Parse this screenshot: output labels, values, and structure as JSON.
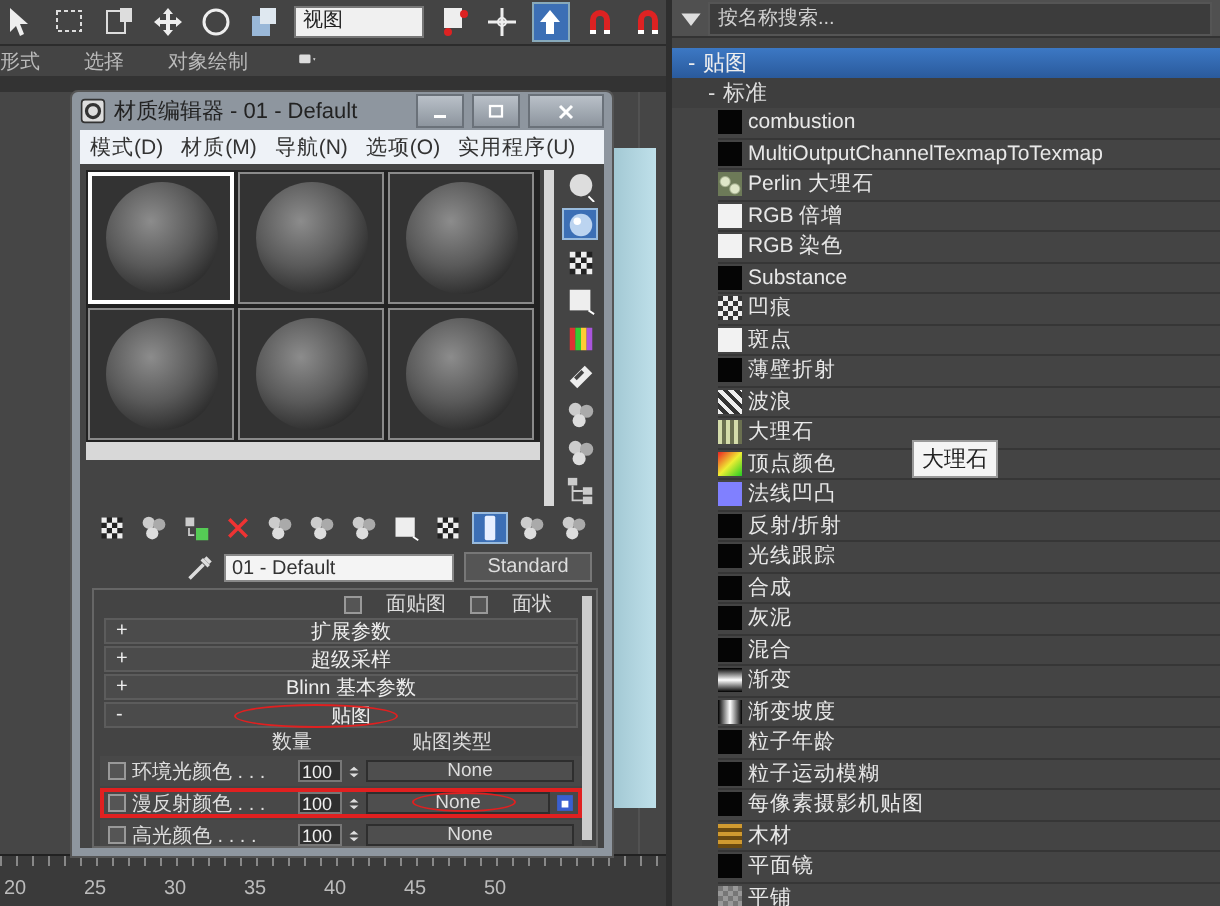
{
  "top_toolbar": {
    "tools": [
      {
        "kind": "cursor",
        "selected": false
      },
      {
        "kind": "rect-select",
        "selected": false
      },
      {
        "kind": "window-select",
        "selected": false
      },
      {
        "kind": "move",
        "selected": false
      },
      {
        "kind": "rotate",
        "selected": false
      },
      {
        "kind": "scale",
        "selected": false
      },
      {
        "kind": "field",
        "value": "视图"
      },
      {
        "kind": "pivot",
        "selected": false
      },
      {
        "kind": "snap",
        "selected": false
      },
      {
        "kind": "up-arrow",
        "selected": true
      },
      {
        "kind": "magnet",
        "selected": false
      },
      {
        "kind": "magnet",
        "selected": false
      }
    ]
  },
  "ribbon_labels": [
    "形式",
    "选择",
    "对象绘制"
  ],
  "material_editor": {
    "title": "材质编辑器 - 01 - Default",
    "menu": [
      "模式(D)",
      "材质(M)",
      "导航(N)",
      "选项(O)",
      "实用程序(U)"
    ],
    "spheres": [
      {
        "selected": true
      },
      {
        "selected": false
      },
      {
        "selected": false
      },
      {
        "selected": false
      },
      {
        "selected": false
      },
      {
        "selected": false
      }
    ],
    "side_tools": [
      {
        "kind": "sphere",
        "selected": false
      },
      {
        "kind": "light",
        "selected": true
      },
      {
        "kind": "checker",
        "selected": false
      },
      {
        "kind": "square",
        "selected": false
      },
      {
        "kind": "bars",
        "selected": false
      },
      {
        "kind": "tape",
        "selected": false
      },
      {
        "kind": "spheres",
        "selected": false
      },
      {
        "kind": "spheres",
        "selected": false
      },
      {
        "kind": "tree",
        "selected": false
      }
    ],
    "bottom_tools": [
      {
        "kind": "checker",
        "selected": false
      },
      {
        "kind": "spheres",
        "selected": false
      },
      {
        "kind": "assign",
        "selected": false
      },
      {
        "kind": "delete",
        "selected": false
      },
      {
        "kind": "spheres",
        "selected": false
      },
      {
        "kind": "spheres",
        "selected": false
      },
      {
        "kind": "spheres",
        "selected": false
      },
      {
        "kind": "square",
        "selected": false
      },
      {
        "kind": "checker",
        "selected": false
      },
      {
        "kind": "bar",
        "selected": true
      },
      {
        "kind": "spheres",
        "selected": false
      },
      {
        "kind": "spheres",
        "selected": false
      }
    ],
    "material_name": "01 - Default",
    "material_type": "Standard",
    "checkboxes": [
      {
        "label": "面贴图",
        "checked": false
      },
      {
        "label": "面状",
        "checked": false
      }
    ],
    "rollouts": [
      {
        "toggle": "+",
        "label": "扩展参数",
        "circled": false
      },
      {
        "toggle": "+",
        "label": "超级采样",
        "circled": false
      },
      {
        "toggle": "+",
        "label": "Blinn 基本参数",
        "circled": false
      },
      {
        "toggle": "-",
        "label": "贴图",
        "circled": true
      }
    ],
    "maps_columns": {
      "amount": "数量",
      "map_type": "贴图类型"
    },
    "map_rows": [
      {
        "name": "环境光颜色 . . .",
        "amount": "100",
        "map": "None",
        "enabled": false,
        "highlighted": false,
        "circled": false
      },
      {
        "name": "漫反射颜色 . . .",
        "amount": "100",
        "map": "None",
        "enabled": false,
        "highlighted": true,
        "circled": true
      },
      {
        "name": "高光颜色 . . . .",
        "amount": "100",
        "map": "None",
        "enabled": false,
        "highlighted": false,
        "circled": false
      }
    ]
  },
  "ruler": [
    "20",
    "25",
    "30",
    "35",
    "40",
    "45",
    "50"
  ],
  "map_browser": {
    "search": {
      "placeholder": "按名称搜索..."
    },
    "group": {
      "toggle": "-",
      "label": "贴图",
      "selected": true
    },
    "subgroup": {
      "toggle": "-",
      "label": "标准"
    },
    "items": [
      {
        "label": "combustion",
        "kind": "black"
      },
      {
        "label": "MultiOutputChannelTexmapToTexmap",
        "kind": "black"
      },
      {
        "label": "Perlin 大理石",
        "kind": "perlin"
      },
      {
        "label": "RGB 倍增",
        "kind": "white"
      },
      {
        "label": "RGB 染色",
        "kind": "white"
      },
      {
        "label": "Substance",
        "kind": "black"
      },
      {
        "label": "凹痕",
        "kind": "dent"
      },
      {
        "label": "斑点",
        "kind": "white"
      },
      {
        "label": "薄壁折射",
        "kind": "black"
      },
      {
        "label": "波浪",
        "kind": "wave"
      },
      {
        "label": "大理石",
        "kind": "marble"
      },
      {
        "label": "顶点颜色",
        "kind": "rainbow"
      },
      {
        "label": "法线凹凸",
        "kind": "purple"
      },
      {
        "label": "反射/折射",
        "kind": "black"
      },
      {
        "label": "光线跟踪",
        "kind": "black"
      },
      {
        "label": "合成",
        "kind": "black"
      },
      {
        "label": "灰泥",
        "kind": "black"
      },
      {
        "label": "混合",
        "kind": "black"
      },
      {
        "label": "渐变",
        "kind": "gradient"
      },
      {
        "label": "渐变坡度",
        "kind": "ramp"
      },
      {
        "label": "粒子年龄",
        "kind": "black"
      },
      {
        "label": "粒子运动模糊",
        "kind": "black"
      },
      {
        "label": "每像素摄影机贴图",
        "kind": "black"
      },
      {
        "label": "木材",
        "kind": "wood"
      },
      {
        "label": "平面镜",
        "kind": "black"
      },
      {
        "label": "平铺",
        "kind": "tile"
      }
    ],
    "tooltip": "大理石"
  }
}
